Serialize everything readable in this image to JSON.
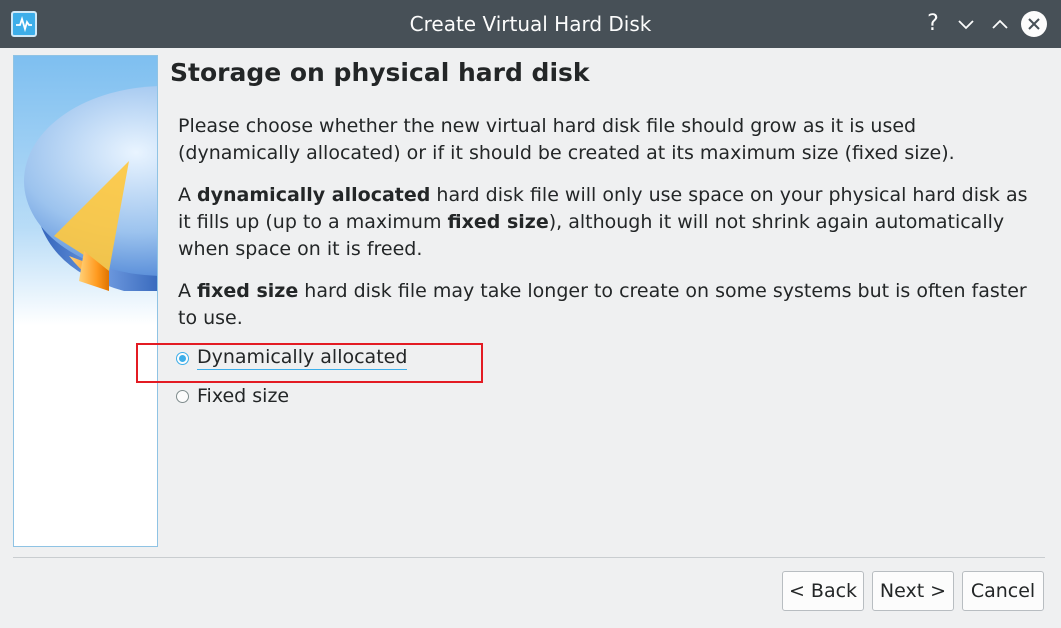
{
  "window": {
    "title": "Create Virtual Hard Disk",
    "help_glyph": "?",
    "minimize_glyph": "⌵",
    "maximize_glyph": "⌃",
    "close_glyph": "✕"
  },
  "page": {
    "heading": "Storage on physical hard disk",
    "para1": "Please choose whether the new virtual hard disk file should grow as it is used (dynamically allocated) or if it should be created at its maximum size (fixed size).",
    "para2": {
      "t1": "A ",
      "b1": "dynamically allocated",
      "t2": " hard disk file will only use space on your physical hard disk as it fills up (up to a maximum ",
      "b2": "fixed size",
      "t3": "), although it will not shrink again automatically when space on it is freed."
    },
    "para3": {
      "t1": "A ",
      "b1": "fixed size",
      "t2": " hard disk file may take longer to create on some systems but is often faster to use."
    }
  },
  "options": [
    {
      "label": "Dynamically allocated",
      "checked": true
    },
    {
      "label": "Fixed size",
      "checked": false
    }
  ],
  "buttons": {
    "back": "< Back",
    "next": "Next >",
    "cancel": "Cancel"
  },
  "colors": {
    "titlebar": "#475057",
    "accent": "#3daee9",
    "highlight": "#e31b23"
  }
}
